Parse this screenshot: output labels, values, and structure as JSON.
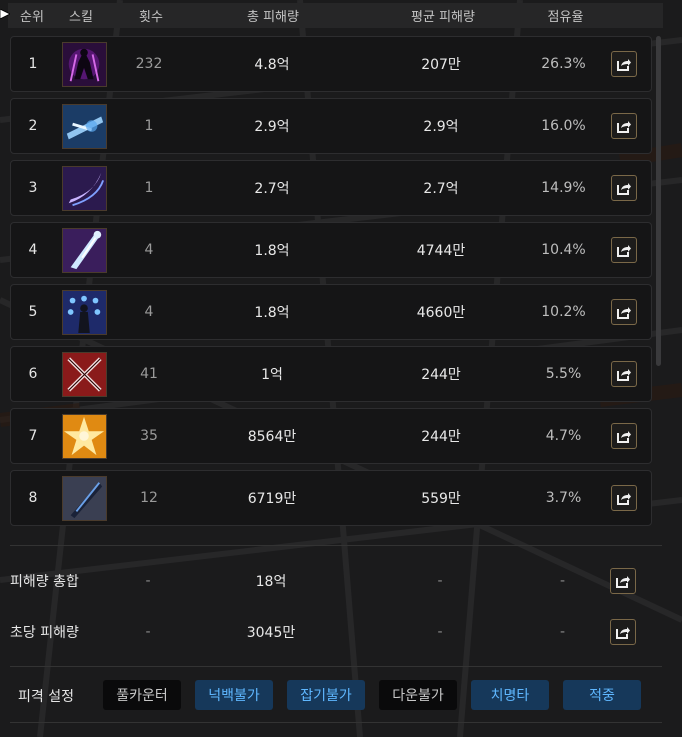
{
  "header": {
    "rank": "순위",
    "skill": "스킬",
    "count": "횟수",
    "total": "총 피해량",
    "avg": "평균 피해량",
    "share": "점유율"
  },
  "rows": [
    {
      "rank": "1",
      "count": "232",
      "total": "4.8억",
      "avg": "207만",
      "share": "26.3%",
      "icon": "shadow-figure-icon"
    },
    {
      "rank": "2",
      "count": "1",
      "total": "2.9억",
      "avg": "2.9억",
      "share": "16.0%",
      "icon": "blue-slash-icon"
    },
    {
      "rank": "3",
      "count": "1",
      "total": "2.7억",
      "avg": "2.7억",
      "share": "14.9%",
      "icon": "purple-crescent-icon"
    },
    {
      "rank": "4",
      "count": "4",
      "total": "1.8억",
      "avg": "4744만",
      "share": "10.4%",
      "icon": "sword-rain-icon"
    },
    {
      "rank": "5",
      "count": "4",
      "total": "1.8억",
      "avg": "4660만",
      "share": "10.2%",
      "icon": "summon-orbs-icon"
    },
    {
      "rank": "6",
      "count": "41",
      "total": "1억",
      "avg": "244만",
      "share": "5.5%",
      "icon": "crossed-swords-icon"
    },
    {
      "rank": "7",
      "count": "35",
      "total": "8564만",
      "avg": "244만",
      "share": "4.7%",
      "icon": "golden-burst-icon"
    },
    {
      "rank": "8",
      "count": "12",
      "total": "6719만",
      "avg": "559만",
      "share": "3.7%",
      "icon": "dark-blade-icon"
    }
  ],
  "summary": [
    {
      "label": "피해량 총합",
      "count": "-",
      "total": "18억",
      "avg": "-",
      "share": "-"
    },
    {
      "label": "초당 피해량",
      "count": "-",
      "total": "3045만",
      "avg": "-",
      "share": "-"
    }
  ],
  "settings": {
    "label": "피격 설정",
    "toggles": [
      {
        "label": "풀카운터",
        "active": false
      },
      {
        "label": "넉백불가",
        "active": true
      },
      {
        "label": "잡기불가",
        "active": true
      },
      {
        "label": "다운불가",
        "active": false
      },
      {
        "label": "치명타",
        "active": true
      },
      {
        "label": "적중",
        "active": true
      }
    ]
  },
  "colors": {
    "accent": "#5fb7ff",
    "toggle_on_bg": "#16385a",
    "toggle_off_bg": "#0a0a0b",
    "share_button_border": "#7a6848"
  }
}
